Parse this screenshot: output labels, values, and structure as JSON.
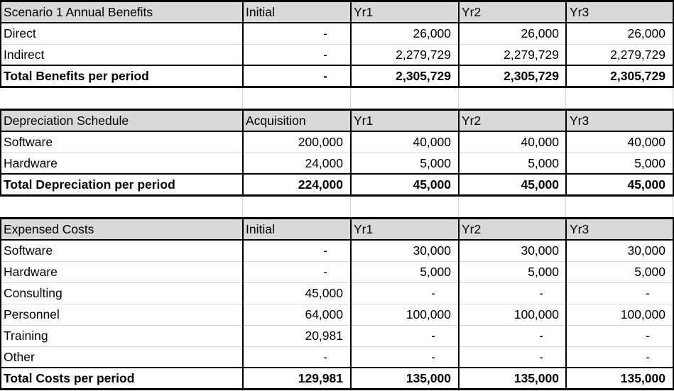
{
  "sections": [
    {
      "title": "Scenario 1 Annual Benefits",
      "columns": [
        "Initial",
        "Yr1",
        "Yr2",
        "Yr3"
      ],
      "rows": [
        {
          "label": "Direct",
          "values": [
            "-",
            "26,000",
            "26,000",
            "26,000"
          ]
        },
        {
          "label": "Indirect",
          "values": [
            "-",
            "2,279,729",
            "2,279,729",
            "2,279,729"
          ]
        }
      ],
      "total": {
        "label": "Total Benefits per period",
        "values": [
          "-",
          "2,305,729",
          "2,305,729",
          "2,305,729"
        ]
      }
    },
    {
      "title": "Depreciation Schedule",
      "columns": [
        "Acquisition",
        "Yr1",
        "Yr2",
        "Yr3"
      ],
      "rows": [
        {
          "label": "Software",
          "values": [
            "200,000",
            "40,000",
            "40,000",
            "40,000"
          ]
        },
        {
          "label": "Hardware",
          "values": [
            "24,000",
            "5,000",
            "5,000",
            "5,000"
          ]
        }
      ],
      "total": {
        "label": "Total Depreciation per period",
        "values": [
          "224,000",
          "45,000",
          "45,000",
          "45,000"
        ]
      }
    },
    {
      "title": "Expensed Costs",
      "columns": [
        "Initial",
        "Yr1",
        "Yr2",
        "Yr3"
      ],
      "rows": [
        {
          "label": "Software",
          "values": [
            "-",
            "30,000",
            "30,000",
            "30,000"
          ]
        },
        {
          "label": "Hardware",
          "values": [
            "-",
            "5,000",
            "5,000",
            "5,000"
          ]
        },
        {
          "label": "Consulting",
          "values": [
            "45,000",
            "-",
            "-",
            "-"
          ]
        },
        {
          "label": "Personnel",
          "values": [
            "64,000",
            "100,000",
            "100,000",
            "100,000"
          ]
        },
        {
          "label": "Training",
          "values": [
            "20,981",
            "-",
            "-",
            "-"
          ]
        },
        {
          "label": "Other",
          "values": [
            "-",
            "-",
            "-",
            "-"
          ]
        }
      ],
      "total": {
        "label": "Total Costs per period",
        "values": [
          "129,981",
          "135,000",
          "135,000",
          "135,000"
        ]
      }
    }
  ]
}
